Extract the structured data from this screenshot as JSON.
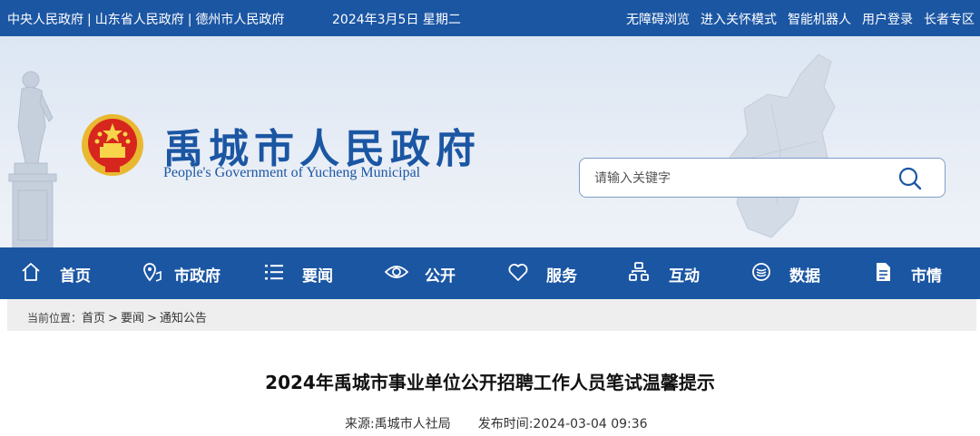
{
  "topbar": {
    "links": [
      "中央人民政府",
      "山东省人民政府",
      "德州市人民政府"
    ],
    "separator": "|",
    "date": "2024年3月5日 星期二",
    "right_links": [
      "无障碍浏览",
      "进入关怀模式",
      "智能机器人",
      "用户登录",
      "长者专区"
    ]
  },
  "header": {
    "title": "禹城市人民政府",
    "subtitle": "People's Government of  Yucheng Municipal",
    "emblem_icon": "national-emblem-icon",
    "search": {
      "placeholder": "请输入关键字",
      "icon": "search-icon"
    }
  },
  "nav": {
    "items": [
      {
        "label": "首页",
        "icon": "home-icon"
      },
      {
        "label": "市政府",
        "icon": "location-pin-icon"
      },
      {
        "label": "要闻",
        "icon": "list-icon"
      },
      {
        "label": "公开",
        "icon": "eye-icon"
      },
      {
        "label": "服务",
        "icon": "heart-icon"
      },
      {
        "label": "互动",
        "icon": "interaction-icon"
      },
      {
        "label": "数据",
        "icon": "database-icon"
      },
      {
        "label": "市情",
        "icon": "document-icon"
      }
    ]
  },
  "breadcrumb": {
    "label": "当前位置：",
    "items": [
      "首页",
      "要闻",
      "通知公告"
    ],
    "separator": ">"
  },
  "article": {
    "title": "2024年禹城市事业单位公开招聘工作人员笔试温馨提示",
    "source": "来源:禹城市人社局",
    "published": "发布时间:2024-03-04 09:36"
  },
  "colors": {
    "primary": "#1b56a3",
    "header_bg": "#e3eaf4",
    "breadcrumb_bg": "#eeeeee"
  }
}
